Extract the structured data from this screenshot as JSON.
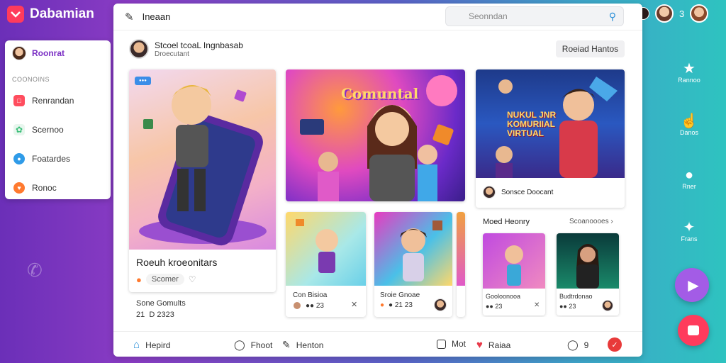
{
  "brand": {
    "name": "Dabamian"
  },
  "top_right": {
    "count": "3"
  },
  "sidebar": {
    "profile": "Roonrat",
    "section": "COONOINS",
    "items": [
      {
        "label": "Renrandan",
        "icon": "chat-icon",
        "color": "#ff4d5e"
      },
      {
        "label": "Scernoo",
        "icon": "leaf-icon",
        "color": "#3cbf7a"
      },
      {
        "label": "Foatardes",
        "icon": "globe-icon",
        "color": "#2f9be8"
      },
      {
        "label": "Ronoc",
        "icon": "heart-icon",
        "color": "#ff7a2f"
      }
    ]
  },
  "header": {
    "title": "Ineaan",
    "search_placeholder": "Seonndan"
  },
  "poster": {
    "name": "Stcoel tcoaL Ingnbasab",
    "sub": "Droecutant"
  },
  "read_button": "Roeiad Hantos",
  "featured": {
    "badge": "●●●",
    "title": "Roeuh kroeonitars",
    "tag": "Scomer",
    "meta_title": "Sone Gomults",
    "meta_numbers": "21  D 2323"
  },
  "community": {
    "banner": "Comuntal"
  },
  "virtual": {
    "banner": "NUKUL JNR KOMURIIAL VIRTUAL",
    "owner": "Sonsce Doocant"
  },
  "small_cards": [
    {
      "title": "Con Bisioa",
      "meta": "●● 23"
    },
    {
      "title": "Sroie Gnoae",
      "meta": "● 21 23"
    }
  ],
  "most_recent": {
    "label": "Moed Heonry",
    "more": "Scoanoooes"
  },
  "recent_cards": [
    {
      "title": "Gooloonooa",
      "meta": "●● 23"
    },
    {
      "title": "Budtrdonao",
      "meta": "●● 23"
    }
  ],
  "bottom_nav": {
    "home": "Hepird",
    "feed": "Fhoot",
    "mentions": "Henton",
    "mail": "Mot",
    "rates": "Raiaa",
    "notif": "9"
  },
  "right_rail": [
    {
      "label": "Rannoo",
      "icon": "puzzle-icon"
    },
    {
      "label": "Danos",
      "icon": "hand-icon"
    },
    {
      "label": "Rner",
      "icon": "speech-icon"
    },
    {
      "label": "Frans",
      "icon": "wave-icon"
    }
  ],
  "colors": {
    "brand": "#ff3b5c",
    "accent": "#7a2ec4",
    "fab_play": "#a35ce6",
    "fab_chat": "#ff3b5c"
  }
}
